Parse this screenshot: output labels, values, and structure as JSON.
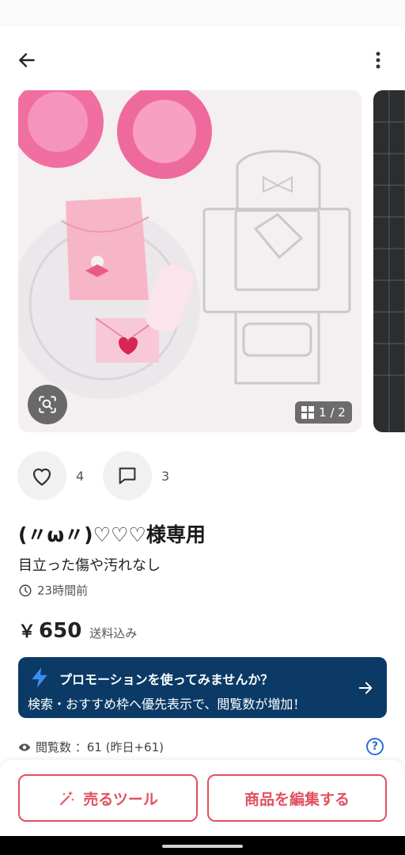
{
  "header": {
    "back_icon": "arrow-left-icon",
    "more_icon": "more-vertical-icon"
  },
  "gallery": {
    "counter": "1 / 2",
    "lens_icon": "image-search-icon",
    "grid_icon": "grid-icon"
  },
  "stats": {
    "likes": "4",
    "comments": "3"
  },
  "item": {
    "title": "(〃ω〃)♡♡♡様専用",
    "condition": "目立った傷や汚れなし",
    "posted": "23時間前"
  },
  "price": {
    "currency": "￥",
    "amount": "650",
    "shipping": "送料込み"
  },
  "promo": {
    "title": "プロモーションを使ってみませんか？",
    "subtitle": "検索・おすすめ枠へ優先表示で、閲覧数が増加！",
    "color": "#0b3a66"
  },
  "views": {
    "label": "閲覧数 ：61 (昨日+61)"
  },
  "buttons": {
    "sell_tool": "売るツール",
    "edit": "商品を編集する",
    "accent": "#e2505e"
  }
}
